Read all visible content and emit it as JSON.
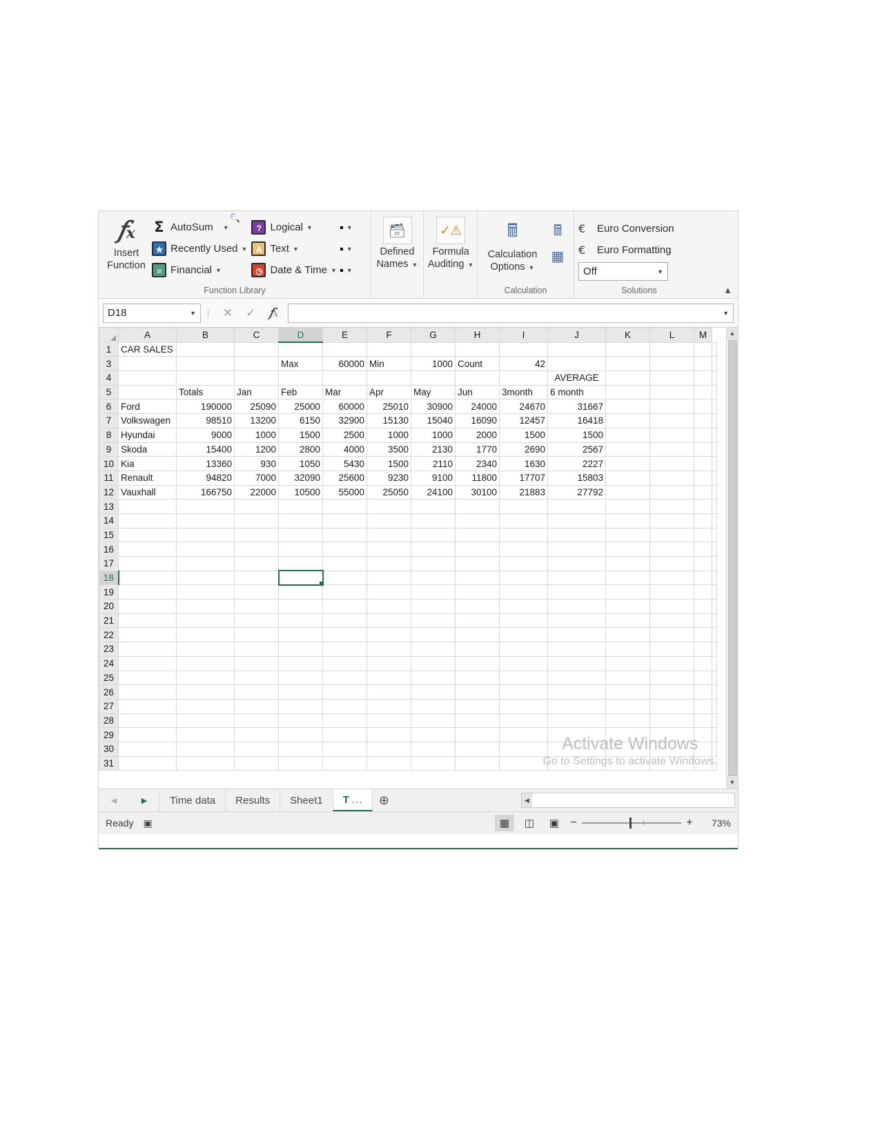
{
  "ribbon": {
    "insert_function": {
      "line1": "Insert",
      "line2": "Function",
      "glyph": "fx"
    },
    "function_library": {
      "title": "Function Library",
      "items": [
        {
          "label": "AutoSum",
          "icon": "sigma-icon"
        },
        {
          "label": "Recently Used",
          "icon": "recently-used-icon"
        },
        {
          "label": "Financial",
          "icon": "financial-icon"
        },
        {
          "label": "Logical",
          "icon": "logical-icon"
        },
        {
          "label": "Text",
          "icon": "text-icon"
        },
        {
          "label": "Date & Time",
          "icon": "date-time-icon"
        }
      ],
      "icon_only": [
        "lookup-reference-icon",
        "math-trig-icon",
        "more-functions-icon"
      ]
    },
    "defined_names": {
      "l1": "Defined",
      "l2": "Names",
      "icon": "defined-names-icon"
    },
    "formula_auditing": {
      "l1": "Formula",
      "l2": "Auditing",
      "icon": "formula-auditing-icon"
    },
    "calculation": {
      "title": "Calculation",
      "l1": "Calculation",
      "l2": "Options",
      "icon": "calculation-options-icon",
      "small_icons": [
        "calculate-now-icon",
        "calculate-sheet-icon"
      ]
    },
    "solutions": {
      "title": "Solutions",
      "euro_conversion": "Euro Conversion",
      "euro_formatting": "Euro Formatting",
      "dropdown_value": "Off"
    },
    "collapse_icon": "chevron-up-icon"
  },
  "formula_bar": {
    "name_box_value": "D18",
    "cancel_icon": "cancel-icon",
    "enter_icon": "enter-icon",
    "insert_function_icon": "fx-icon",
    "formula_value": "",
    "expand_icon": "chevron-down-icon"
  },
  "grid": {
    "columns": [
      "A",
      "B",
      "C",
      "D",
      "E",
      "F",
      "G",
      "H",
      "I",
      "J",
      "K",
      "L",
      "M"
    ],
    "selected_column": "D",
    "selected_row": 18,
    "selected_cell": "D18",
    "rows": [
      {
        "num": "1",
        "cells": [
          "CAR SALES",
          "",
          "",
          "",
          "",
          "",
          "",
          "",
          "",
          "",
          "",
          "",
          ""
        ]
      },
      {
        "num": "3",
        "cells": [
          "",
          "",
          "",
          "Max",
          "60000",
          "Min",
          "1000",
          "Count",
          "42",
          "",
          "",
          "",
          ""
        ]
      },
      {
        "num": "4",
        "cells": [
          "",
          "",
          "",
          "",
          "",
          "",
          "",
          "",
          "",
          "AVERAGE",
          "",
          "",
          ""
        ]
      },
      {
        "num": "5",
        "cells": [
          "",
          "Totals",
          "Jan",
          "Feb",
          "Mar",
          "Apr",
          "May",
          "Jun",
          "3month",
          "6 month",
          "",
          "",
          ""
        ]
      },
      {
        "num": "6",
        "cells": [
          "Ford",
          "190000",
          "25090",
          "25000",
          "60000",
          "25010",
          "30900",
          "24000",
          "24670",
          "31667",
          "",
          "",
          ""
        ]
      },
      {
        "num": "7",
        "cells": [
          "Volkswagen",
          "98510",
          "13200",
          "6150",
          "32900",
          "15130",
          "15040",
          "16090",
          "12457",
          "16418",
          "",
          "",
          ""
        ]
      },
      {
        "num": "8",
        "cells": [
          "Hyundai",
          "9000",
          "1000",
          "1500",
          "2500",
          "1000",
          "1000",
          "2000",
          "1500",
          "1500",
          "",
          "",
          ""
        ]
      },
      {
        "num": "9",
        "cells": [
          "Skoda",
          "15400",
          "1200",
          "2800",
          "4000",
          "3500",
          "2130",
          "1770",
          "2690",
          "2567",
          "",
          "",
          ""
        ]
      },
      {
        "num": "10",
        "cells": [
          "Kia",
          "13360",
          "930",
          "1050",
          "5430",
          "1500",
          "2110",
          "2340",
          "1630",
          "2227",
          "",
          "",
          ""
        ]
      },
      {
        "num": "11",
        "cells": [
          "Renault",
          "94820",
          "7000",
          "32090",
          "25600",
          "9230",
          "9100",
          "11800",
          "17707",
          "15803",
          "",
          "",
          ""
        ]
      },
      {
        "num": "12",
        "cells": [
          "Vauxhall",
          "166750",
          "22000",
          "10500",
          "55000",
          "25050",
          "24100",
          "30100",
          "21883",
          "27792",
          "",
          "",
          ""
        ]
      },
      {
        "num": "13",
        "cells": [
          "",
          "",
          "",
          "",
          "",
          "",
          "",
          "",
          "",
          "",
          "",
          "",
          ""
        ]
      },
      {
        "num": "14",
        "cells": [
          "",
          "",
          "",
          "",
          "",
          "",
          "",
          "",
          "",
          "",
          "",
          "",
          ""
        ]
      },
      {
        "num": "15",
        "cells": [
          "",
          "",
          "",
          "",
          "",
          "",
          "",
          "",
          "",
          "",
          "",
          "",
          ""
        ]
      },
      {
        "num": "16",
        "cells": [
          "",
          "",
          "",
          "",
          "",
          "",
          "",
          "",
          "",
          "",
          "",
          "",
          ""
        ]
      },
      {
        "num": "17",
        "cells": [
          "",
          "",
          "",
          "",
          "",
          "",
          "",
          "",
          "",
          "",
          "",
          "",
          ""
        ]
      },
      {
        "num": "18",
        "cells": [
          "",
          "",
          "",
          "",
          "",
          "",
          "",
          "",
          "",
          "",
          "",
          "",
          ""
        ]
      },
      {
        "num": "19",
        "cells": [
          "",
          "",
          "",
          "",
          "",
          "",
          "",
          "",
          "",
          "",
          "",
          "",
          ""
        ]
      },
      {
        "num": "20",
        "cells": [
          "",
          "",
          "",
          "",
          "",
          "",
          "",
          "",
          "",
          "",
          "",
          "",
          ""
        ]
      },
      {
        "num": "21",
        "cells": [
          "",
          "",
          "",
          "",
          "",
          "",
          "",
          "",
          "",
          "",
          "",
          "",
          ""
        ]
      },
      {
        "num": "22",
        "cells": [
          "",
          "",
          "",
          "",
          "",
          "",
          "",
          "",
          "",
          "",
          "",
          "",
          ""
        ]
      },
      {
        "num": "23",
        "cells": [
          "",
          "",
          "",
          "",
          "",
          "",
          "",
          "",
          "",
          "",
          "",
          "",
          ""
        ]
      },
      {
        "num": "24",
        "cells": [
          "",
          "",
          "",
          "",
          "",
          "",
          "",
          "",
          "",
          "",
          "",
          "",
          ""
        ]
      },
      {
        "num": "25",
        "cells": [
          "",
          "",
          "",
          "",
          "",
          "",
          "",
          "",
          "",
          "",
          "",
          "",
          ""
        ]
      },
      {
        "num": "26",
        "cells": [
          "",
          "",
          "",
          "",
          "",
          "",
          "",
          "",
          "",
          "",
          "",
          "",
          ""
        ]
      },
      {
        "num": "27",
        "cells": [
          "",
          "",
          "",
          "",
          "",
          "",
          "",
          "",
          "",
          "",
          "",
          "",
          ""
        ]
      },
      {
        "num": "28",
        "cells": [
          "",
          "",
          "",
          "",
          "",
          "",
          "",
          "",
          "",
          "",
          "",
          "",
          ""
        ]
      },
      {
        "num": "29",
        "cells": [
          "",
          "",
          "",
          "",
          "",
          "",
          "",
          "",
          "",
          "",
          "",
          "",
          ""
        ]
      },
      {
        "num": "30",
        "cells": [
          "",
          "",
          "",
          "",
          "",
          "",
          "",
          "",
          "",
          "",
          "",
          "",
          ""
        ]
      },
      {
        "num": "31",
        "cells": [
          "",
          "",
          "",
          "",
          "",
          "",
          "",
          "",
          "",
          "",
          "",
          "",
          ""
        ]
      }
    ]
  },
  "watermark": {
    "line1": "Activate Windows",
    "line2": "Go to Settings to activate Windows."
  },
  "tabs": {
    "prev_icon": "triangle-left-icon",
    "next_icon": "triangle-right-icon",
    "sheets": [
      {
        "label": "Time data",
        "active": false
      },
      {
        "label": "Results",
        "active": false
      },
      {
        "label": "Sheet1",
        "active": false
      },
      {
        "label": "T",
        "truncated": "...",
        "active": true
      }
    ],
    "add_sheet_icon": "plus-circle-icon"
  },
  "status": {
    "text": "Ready",
    "macro_icon": "record-macro-icon",
    "view_normal_icon": "normal-view-icon",
    "view_layout_icon": "page-layout-icon",
    "view_break_icon": "page-break-icon",
    "zoom_out_icon": "minus-icon",
    "zoom_in_icon": "plus-icon",
    "zoom_level": "73%"
  },
  "chart_data": {
    "type": "table",
    "title": "CAR SALES",
    "categories": [
      "Ford",
      "Volkswagen",
      "Hyundai",
      "Skoda",
      "Kia",
      "Renault",
      "Vauxhall"
    ],
    "columns": [
      "Totals",
      "Jan",
      "Feb",
      "Mar",
      "Apr",
      "May",
      "Jun",
      "3month",
      "6 month"
    ],
    "values": [
      [
        190000,
        25090,
        25000,
        60000,
        25010,
        30900,
        24000,
        24670,
        31667
      ],
      [
        98510,
        13200,
        6150,
        32900,
        15130,
        15040,
        16090,
        12457,
        16418
      ],
      [
        9000,
        1000,
        1500,
        2500,
        1000,
        1000,
        2000,
        1500,
        1500
      ],
      [
        15400,
        1200,
        2800,
        4000,
        3500,
        2130,
        1770,
        2690,
        2567
      ],
      [
        13360,
        930,
        1050,
        5430,
        1500,
        2110,
        2340,
        1630,
        2227
      ],
      [
        94820,
        7000,
        32090,
        25600,
        9230,
        9100,
        11800,
        17707,
        15803
      ],
      [
        166750,
        22000,
        10500,
        55000,
        25050,
        24100,
        30100,
        21883,
        27792
      ]
    ],
    "summary": {
      "Max": 60000,
      "Min": 1000,
      "Count": 42
    },
    "annotations": [
      "AVERAGE spans 3month and 6 month columns"
    ]
  }
}
